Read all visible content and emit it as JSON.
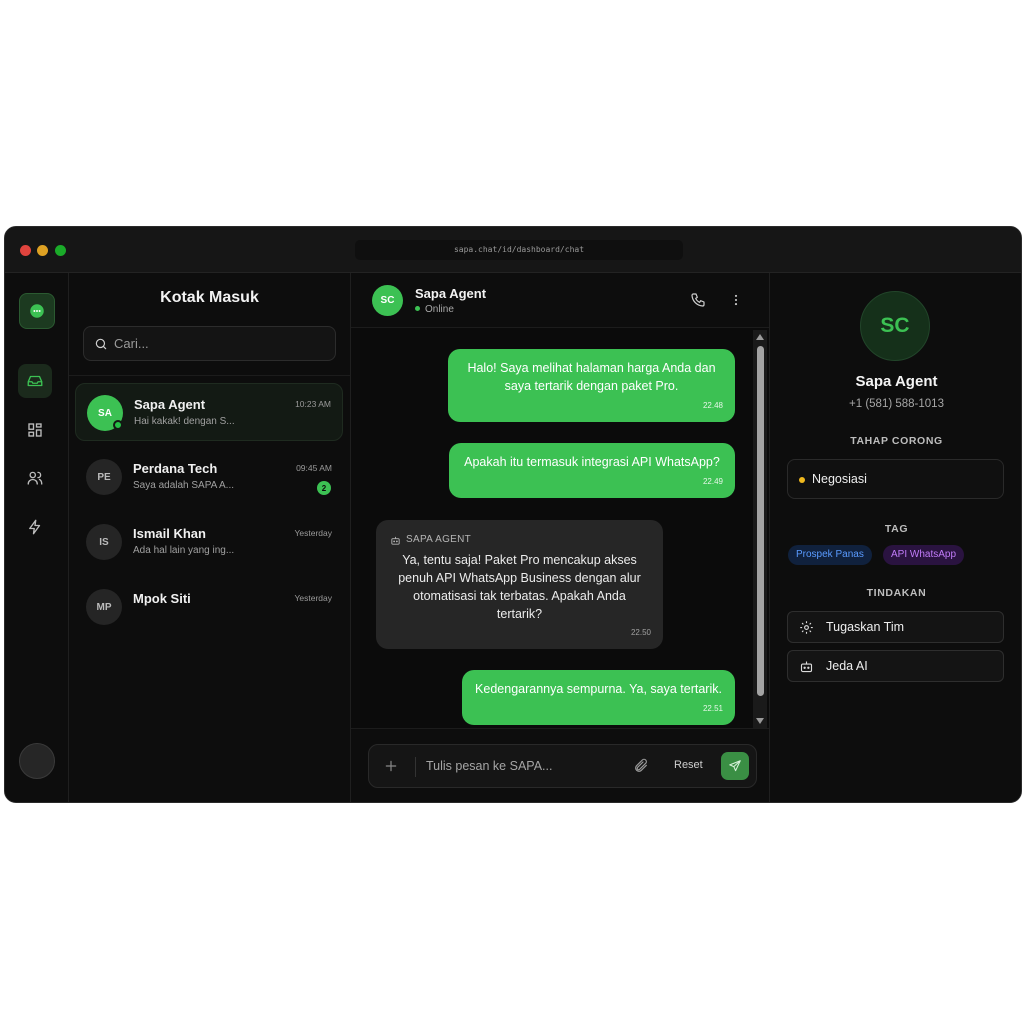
{
  "browser": {
    "url": "sapa.chat/id/dashboard/chat"
  },
  "inbox": {
    "title": "Kotak Masuk",
    "search_placeholder": "Cari...",
    "conversations": [
      {
        "initials": "SA",
        "name": "Sapa Agent",
        "time": "10:23 AM",
        "preview": "Hai kakak! dengan S...",
        "online": true,
        "active": true
      },
      {
        "initials": "PE",
        "name": "Perdana Tech",
        "time": "09:45 AM",
        "preview": "Saya adalah SAPA A...",
        "unread": "2"
      },
      {
        "initials": "IS",
        "name": "Ismail Khan",
        "time": "Yesterday",
        "preview": "Ada hal lain yang ing..."
      },
      {
        "initials": "MP",
        "name": "Mpok Siti",
        "time": "Yesterday",
        "preview": ""
      }
    ]
  },
  "chat": {
    "header": {
      "initials": "SC",
      "name": "Sapa Agent",
      "status": "Online"
    },
    "messages": [
      {
        "direction": "out",
        "text": "Halo! Saya melihat halaman harga Anda dan saya tertarik dengan paket Pro.",
        "time": "22.48"
      },
      {
        "direction": "out",
        "text": "Apakah itu termasuk integrasi API WhatsApp?",
        "time": "22.49"
      },
      {
        "direction": "in",
        "sender": "SAPA AGENT",
        "text": "Ya, tentu saja! Paket Pro mencakup akses penuh API WhatsApp Business dengan alur otomatisasi tak terbatas. Apakah Anda tertarik?",
        "time": "22.50"
      },
      {
        "direction": "out",
        "text": "Kedengarannya sempurna. Ya, saya tertarik.",
        "time": "22.51"
      }
    ],
    "composer": {
      "placeholder": "Tulis pesan ke SAPA...",
      "reset_label": "Reset"
    }
  },
  "profile": {
    "initials": "SC",
    "name": "Sapa Agent",
    "phone": "+1 (581) 588-1013",
    "stage_label": "TAHAP CORONG",
    "stage_value": "Negosiasi",
    "tag_label": "TAG",
    "tags": [
      "Prospek Panas",
      "API WhatsApp"
    ],
    "actions_label": "TINDAKAN",
    "actions": [
      "Tugaskan Tim",
      "Jeda AI"
    ]
  },
  "colors": {
    "accent": "#3cc153",
    "background": "#0d0d0d",
    "stage_dot": "#f0b91e",
    "tag_blue": "#5a9bff",
    "tag_purple": "#c07bf8"
  },
  "icons": [
    "chat-logo-icon",
    "inbox-icon",
    "grid-icon",
    "users-icon",
    "bolt-icon",
    "search-icon",
    "phone-icon",
    "more-vertical-icon",
    "plus-icon",
    "paperclip-icon",
    "send-icon",
    "bot-icon",
    "gear-icon"
  ]
}
